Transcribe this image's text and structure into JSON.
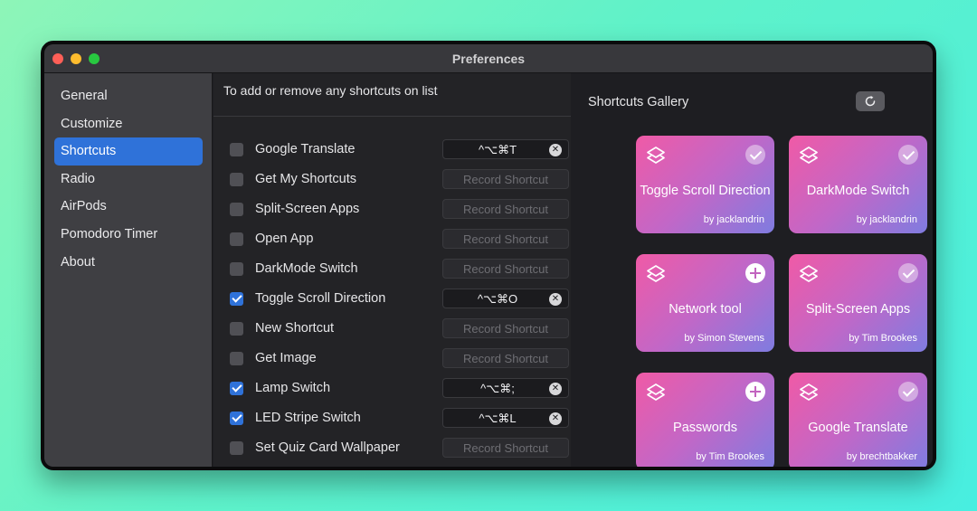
{
  "window": {
    "title": "Preferences"
  },
  "sidebar": {
    "items": [
      {
        "label": "General",
        "active": false
      },
      {
        "label": "Customize",
        "active": false
      },
      {
        "label": "Shortcuts",
        "active": true
      },
      {
        "label": "Radio",
        "active": false
      },
      {
        "label": "AirPods",
        "active": false
      },
      {
        "label": "Pomodoro Timer",
        "active": false
      },
      {
        "label": "About",
        "active": false
      }
    ]
  },
  "shortcuts_list": {
    "heading": "To add or remove any shortcuts on list",
    "record_placeholder": "Record Shortcut",
    "rows": [
      {
        "label": "Google Translate",
        "checked": false,
        "shortcut": "^⌥⌘T"
      },
      {
        "label": "Get My Shortcuts",
        "checked": false,
        "shortcut": ""
      },
      {
        "label": "Split-Screen Apps",
        "checked": false,
        "shortcut": ""
      },
      {
        "label": "Open App",
        "checked": false,
        "shortcut": ""
      },
      {
        "label": "DarkMode Switch",
        "checked": false,
        "shortcut": ""
      },
      {
        "label": "Toggle Scroll Direction",
        "checked": true,
        "shortcut": "^⌥⌘O"
      },
      {
        "label": "New Shortcut",
        "checked": false,
        "shortcut": ""
      },
      {
        "label": "Get Image",
        "checked": false,
        "shortcut": ""
      },
      {
        "label": "Lamp Switch",
        "checked": true,
        "shortcut": "^⌥⌘;"
      },
      {
        "label": "LED Stripe Switch",
        "checked": true,
        "shortcut": "^⌥⌘L"
      },
      {
        "label": "Set Quiz Card Wallpaper",
        "checked": false,
        "shortcut": ""
      }
    ]
  },
  "gallery": {
    "title": "Shortcuts Gallery",
    "refresh_icon": "refresh-icon",
    "cards": [
      {
        "title": "Toggle Scroll Direction",
        "author": "by jacklandrin",
        "action": "check"
      },
      {
        "title": "DarkMode Switch",
        "author": "by jacklandrin",
        "action": "check"
      },
      {
        "title": "Network tool",
        "author": "by Simon Stevens",
        "action": "plus"
      },
      {
        "title": "Split-Screen Apps",
        "author": "by Tim Brookes",
        "action": "check"
      },
      {
        "title": "Passwords",
        "author": "by Tim Brookes",
        "action": "plus"
      },
      {
        "title": "Google Translate",
        "author": "by brechtbakker",
        "action": "check"
      }
    ]
  },
  "colors": {
    "accent": "#2f72d9",
    "card_gradient_start": "#f05aa6",
    "card_gradient_end": "#7f7ce0"
  }
}
